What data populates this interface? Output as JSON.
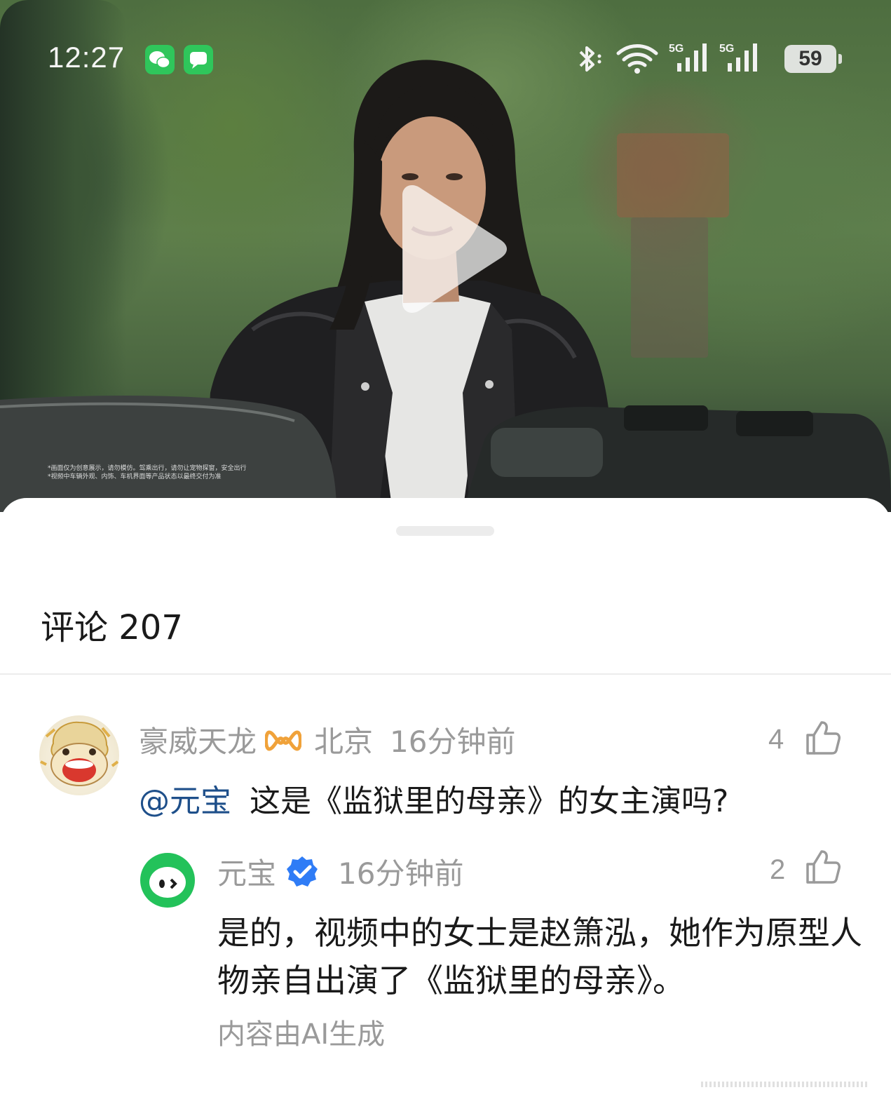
{
  "status_bar": {
    "time": "12:27",
    "battery": "59",
    "signal_labels": [
      "5G",
      "5G"
    ]
  },
  "video": {
    "disclaimer_line1": "*画面仅为创意展示，请勿模仿。驾乘出行，请勿让宠物探窗，安全出行",
    "disclaimer_line2": "*视频中车辆外观、内饰、车机界面等产品状态以最终交付为准"
  },
  "comments": {
    "title": "评论 207",
    "items": [
      {
        "author": "豪威天龙",
        "location": "北京",
        "time": "16分钟前",
        "likes": "4",
        "mention": "@元宝",
        "text": "这是《监狱里的母亲》的女主演吗?"
      }
    ],
    "reply": {
      "author": "元宝",
      "time": "16分钟前",
      "likes": "2",
      "text": "是的，视频中的女士是赵箫泓，她作为原型人物亲自出演了《监狱里的母亲》。",
      "note": "内容由AI生成"
    }
  },
  "colors": {
    "mention": "#1e4f8a",
    "verified_badge": "#2f7cf6",
    "yuanbao_green": "#23c25a",
    "vip_badge": "#f0a23a"
  },
  "icons": [
    "wechat-icon",
    "messages-icon",
    "bluetooth-icon",
    "wifi-icon",
    "signal-icon",
    "play-icon",
    "thumbs-up-icon",
    "verified-icon",
    "vip-icon"
  ]
}
